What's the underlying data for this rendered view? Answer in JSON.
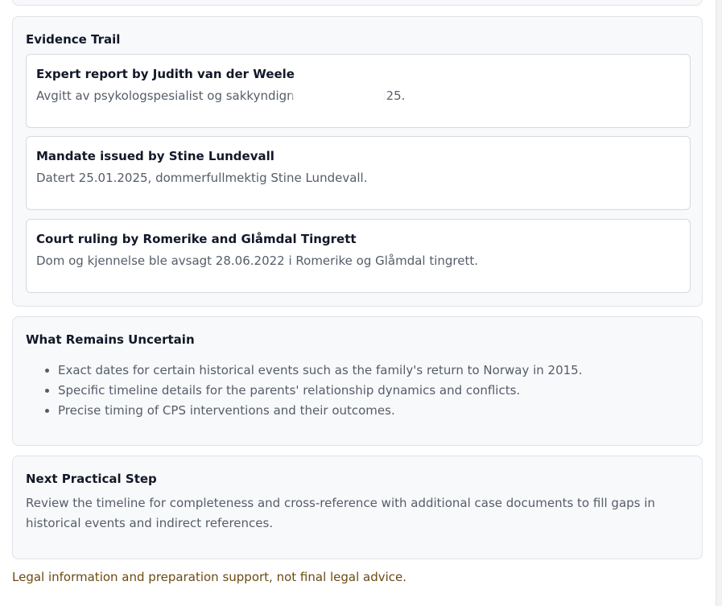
{
  "evidence": {
    "title": "Evidence Trail",
    "items": [
      {
        "title": "Expert report by Judith van der Weele",
        "desc": "Avgitt av psykologspesialist og sakkyndigndi             .09.21.09.2025."
      },
      {
        "title": "Mandate issued by Stine Lundevall",
        "desc": "Datert 25.01.2025, dommerfullmektig Stine Lundevall."
      },
      {
        "title": "Court ruling by Romerike and Glåmdal Tingrett",
        "desc": "Dom og kjennelse ble avsagt 28.06.2022 i Romerike og Glåmdal tingrett."
      }
    ]
  },
  "uncertain": {
    "title": "What Remains Uncertain",
    "items": [
      "Exact dates for certain historical events such as the family's return to Norway in 2015.",
      "Specific timeline details for the parents' relationship dynamics and conflicts.",
      "Precise timing of CPS interventions and their outcomes."
    ]
  },
  "next_step": {
    "title": "Next Practical Step",
    "text": "Review the timeline for completeness and cross-reference with additional case documents to fill gaps in historical events and indirect references."
  },
  "disclaimer": "Legal information and preparation support, not final legal advice."
}
